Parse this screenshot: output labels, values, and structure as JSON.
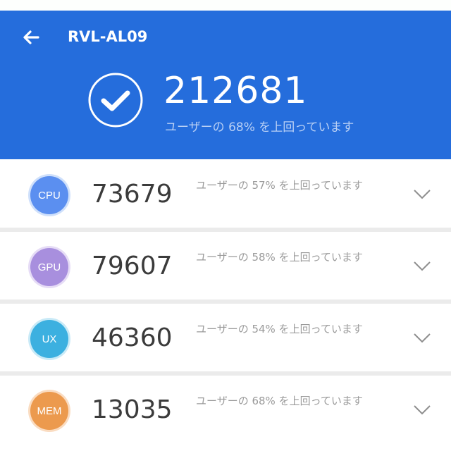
{
  "header": {
    "title": "RVL-AL09",
    "back_icon": "arrow-left-icon",
    "status_icon": "check-circle-icon",
    "total_score": "212681",
    "total_subtitle": "ユーザーの 68% を上回っています",
    "background_color": "#256ddc"
  },
  "categories": [
    {
      "label": "CPU",
      "score": "73679",
      "description": "ユーザーの 57% を上回っています",
      "color": "#5b8ff0",
      "ring_color": "#cfe0fb",
      "percentile": 57
    },
    {
      "label": "GPU",
      "score": "79607",
      "description": "ユーザーの 58% を上回っています",
      "color": "#a88fde",
      "ring_color": "#e6dcf6",
      "percentile": 58
    },
    {
      "label": "UX",
      "score": "46360",
      "description": "ユーザーの 54% を上回っています",
      "color": "#3cb0e0",
      "ring_color": "#c9eaf7",
      "percentile": 54
    },
    {
      "label": "MEM",
      "score": "13035",
      "description": "ユーザーの 68% を上回っています",
      "color": "#ec9a4e",
      "ring_color": "#fadcc1",
      "percentile": 68
    }
  ]
}
